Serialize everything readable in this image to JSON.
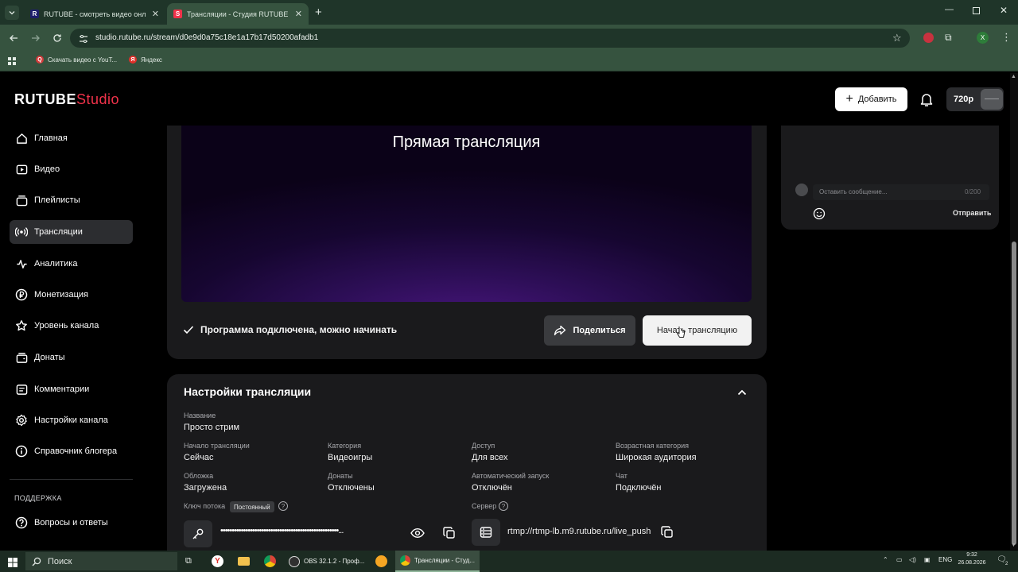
{
  "browser": {
    "tabs": [
      {
        "title": "RUTUBE - смотреть видео онлайн",
        "favicon_letter": "R"
      },
      {
        "title": "Трансляции - Студия RUTUBE",
        "favicon_letter": "S"
      }
    ],
    "url": "studio.rutube.ru/stream/d0e9d0a75c18e1a17b17d50200afadb1",
    "bookmarks": [
      {
        "label": "Скачать видео с YouT...",
        "favicon_letter": "Q"
      },
      {
        "label": "Яндекс",
        "favicon_letter": "Я"
      }
    ],
    "profile_letter": "X"
  },
  "header": {
    "logo_main": "RUTUBE",
    "logo_sub": "Studio",
    "add_label": "Добавить",
    "quality": "720p"
  },
  "sidebar": {
    "items": [
      {
        "label": "Главная",
        "icon": "home-icon"
      },
      {
        "label": "Видео",
        "icon": "video-icon"
      },
      {
        "label": "Плейлисты",
        "icon": "playlist-icon"
      },
      {
        "label": "Трансляции",
        "icon": "broadcast-icon",
        "active": true
      },
      {
        "label": "Аналитика",
        "icon": "analytics-icon"
      },
      {
        "label": "Монетизация",
        "icon": "ruble-icon"
      },
      {
        "label": "Уровень канала",
        "icon": "star-icon"
      },
      {
        "label": "Донаты",
        "icon": "donate-icon"
      },
      {
        "label": "Комментарии",
        "icon": "comments-icon"
      },
      {
        "label": "Настройки канала",
        "icon": "gear-icon"
      },
      {
        "label": "Справочник блогера",
        "icon": "info-icon"
      }
    ],
    "support_heading": "ПОДДЕРЖКА",
    "support_items": [
      {
        "label": "Вопросы и ответы",
        "icon": "question-icon"
      }
    ]
  },
  "player": {
    "title": "Прямая трансляция",
    "status": "Программа подключена, можно начинать",
    "share_label": "Поделиться",
    "start_label": "Начать трансляцию"
  },
  "settings": {
    "title": "Настройки трансляции",
    "name_label": "Название",
    "name_value": "Просто стрим",
    "fields": [
      {
        "label": "Начало трансляции",
        "value": "Сейчас"
      },
      {
        "label": "Категория",
        "value": "Видеоигры"
      },
      {
        "label": "Доступ",
        "value": "Для всех"
      },
      {
        "label": "Возрастная категория",
        "value": "Широкая аудитория"
      },
      {
        "label": "Обложка",
        "value": "Загружена"
      },
      {
        "label": "Донаты",
        "value": "Отключены"
      },
      {
        "label": "Автоматический запуск",
        "value": "Отключён"
      },
      {
        "label": "Чат",
        "value": "Подключён"
      }
    ],
    "key_label": "Ключ потока",
    "key_badge": "Постоянный",
    "key_value": "••••••••••••••••••••••••••••••••••••••••••••••••••••...",
    "server_label": "Сервер",
    "server_value": "rtmp://rtmp-lb.m9.rutube.ru/live_push"
  },
  "chat": {
    "placeholder": "Оставить сообщение...",
    "counter": "0/200",
    "send_label": "Отправить"
  },
  "taskbar": {
    "search_label": "Поиск",
    "apps": [
      {
        "label": "OBS 32.1.2 - Проф...",
        "active": false
      },
      {
        "label": "Трансляции - Студ...",
        "active": true
      }
    ],
    "lang": "ENG",
    "time": "9:32",
    "date": "26.08.2026",
    "notif_count": "2"
  },
  "colors": {
    "brand_red": "#f0324a",
    "chrome_green": "#36533f",
    "card_bg": "#1a1a1c"
  }
}
